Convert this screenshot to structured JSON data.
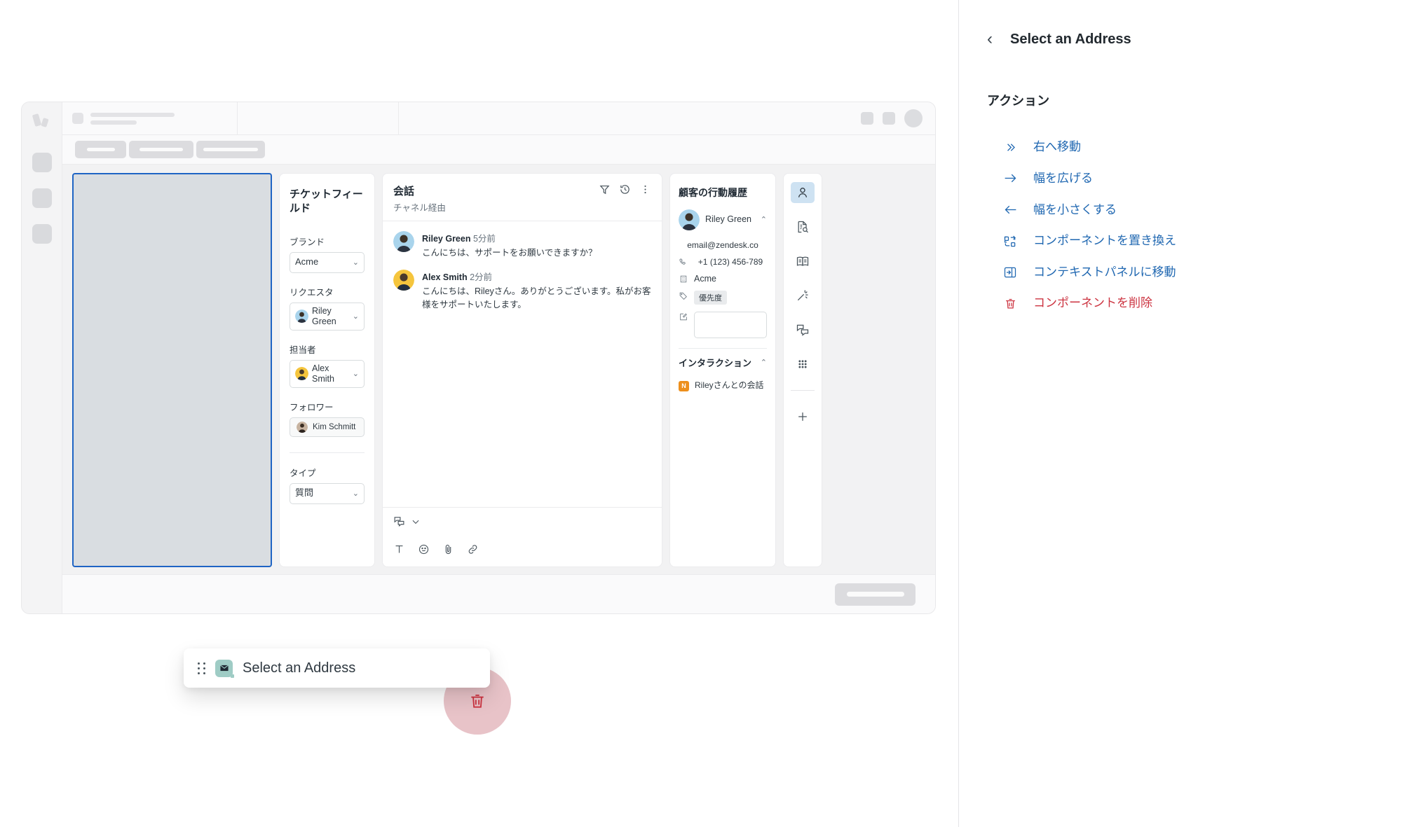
{
  "side_panel": {
    "back_icon": "chevron-left-icon",
    "title": "Select an Address",
    "section_title": "アクション",
    "actions": [
      {
        "icon": "double-chevron-right-icon",
        "label": "右へ移動",
        "color": "#1f67b1"
      },
      {
        "icon": "arrow-right-icon",
        "label": "幅を広げる",
        "color": "#1f67b1"
      },
      {
        "icon": "arrow-left-icon",
        "label": "幅を小さくする",
        "color": "#1f67b1"
      },
      {
        "icon": "swap-component-icon",
        "label": "コンポーネントを置き換え",
        "color": "#1f67b1"
      },
      {
        "icon": "move-to-panel-icon",
        "label": "コンテキストパネルに移動",
        "color": "#1f67b1"
      },
      {
        "icon": "trash-icon",
        "label": "コンポーネントを削除",
        "color": "#cc3340"
      }
    ]
  },
  "drag_card": {
    "grip_icon": "drag-handle-icon",
    "app_icon": "envelope-icon",
    "title": "Select an Address",
    "trash_icon": "trash-icon"
  },
  "mock_app": {
    "logo_icon": "zendesk-logo-icon",
    "ticket_fields": {
      "title": "チケットフィールド",
      "groups": [
        {
          "label": "ブランド",
          "value": "Acme",
          "type": "select"
        },
        {
          "label": "リクエスタ",
          "value": "Riley Green",
          "type": "avatar-select"
        },
        {
          "label": "担当者",
          "value": "Alex Smith",
          "type": "avatar-select"
        },
        {
          "label": "フォロワー",
          "value": "Kim Schmitt",
          "type": "avatar-pill"
        }
      ],
      "type_label": "タイプ",
      "type_value": "質問"
    },
    "conversation": {
      "title": "会話",
      "subtitle": "チャネル経由",
      "action_icons": [
        "filter-icon",
        "history-icon",
        "more-vertical-icon"
      ],
      "messages": [
        {
          "name": "Riley Green",
          "time": "5分前",
          "text": "こんにちは、サポートをお願いできますか？"
        },
        {
          "name": "Alex Smith",
          "time": "2分前",
          "text": "こんにちは、Rileyさん。ありがとうございます。私がお客様をサポートいたします。"
        }
      ],
      "composer_icons": [
        "reply-type-icon",
        "chevron-down-icon"
      ],
      "format_icons": [
        "text-format-icon",
        "emoji-icon",
        "attachment-icon",
        "link-icon"
      ]
    },
    "customer": {
      "title": "顧客の行動履歴",
      "person_name": "Riley Green",
      "collapse_icon": "chevron-up-icon",
      "email": "email@zendesk.co",
      "phone": "+1 (123) 456-789",
      "organization": "Acme",
      "tag": "優先度",
      "notes_value": "",
      "rows_icons": [
        "phone-icon",
        "building-icon",
        "tag-icon",
        "note-icon"
      ],
      "interactions_title": "インタラクション",
      "interactions": [
        {
          "badge": "N",
          "label": "Rileyさんとの会話"
        }
      ]
    },
    "app_rail_icons": [
      "user-icon",
      "document-search-icon",
      "knowledge-book-icon",
      "magic-wand-icon",
      "chat-bubbles-icon",
      "apps-grid-icon",
      "plus-icon"
    ]
  },
  "colors": {
    "accent_blue": "#1f67b1",
    "danger_red": "#cc3340",
    "selection_blue": "#1f64c4",
    "app_emblem": "#9fccc5"
  }
}
